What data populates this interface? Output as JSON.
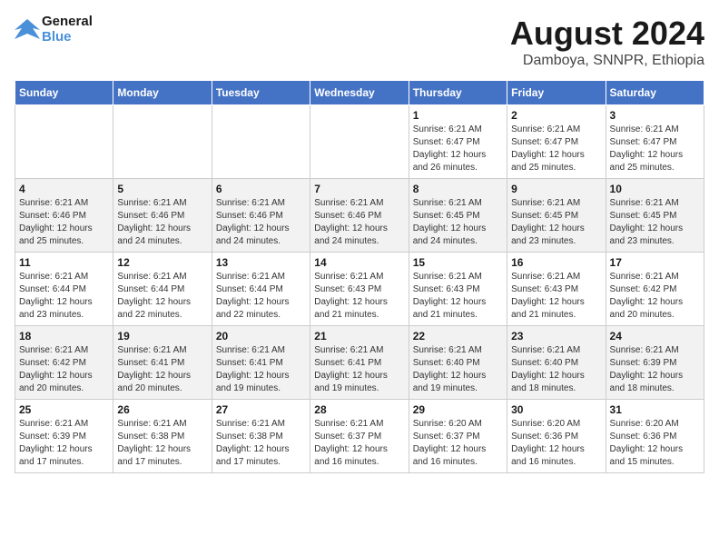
{
  "header": {
    "logo_line1": "General",
    "logo_line2": "Blue",
    "month_year": "August 2024",
    "location": "Damboya, SNNPR, Ethiopia"
  },
  "weekdays": [
    "Sunday",
    "Monday",
    "Tuesday",
    "Wednesday",
    "Thursday",
    "Friday",
    "Saturday"
  ],
  "weeks": [
    [
      {
        "day": "",
        "info": ""
      },
      {
        "day": "",
        "info": ""
      },
      {
        "day": "",
        "info": ""
      },
      {
        "day": "",
        "info": ""
      },
      {
        "day": "1",
        "info": "Sunrise: 6:21 AM\nSunset: 6:47 PM\nDaylight: 12 hours\nand 26 minutes."
      },
      {
        "day": "2",
        "info": "Sunrise: 6:21 AM\nSunset: 6:47 PM\nDaylight: 12 hours\nand 25 minutes."
      },
      {
        "day": "3",
        "info": "Sunrise: 6:21 AM\nSunset: 6:47 PM\nDaylight: 12 hours\nand 25 minutes."
      }
    ],
    [
      {
        "day": "4",
        "info": "Sunrise: 6:21 AM\nSunset: 6:46 PM\nDaylight: 12 hours\nand 25 minutes."
      },
      {
        "day": "5",
        "info": "Sunrise: 6:21 AM\nSunset: 6:46 PM\nDaylight: 12 hours\nand 24 minutes."
      },
      {
        "day": "6",
        "info": "Sunrise: 6:21 AM\nSunset: 6:46 PM\nDaylight: 12 hours\nand 24 minutes."
      },
      {
        "day": "7",
        "info": "Sunrise: 6:21 AM\nSunset: 6:46 PM\nDaylight: 12 hours\nand 24 minutes."
      },
      {
        "day": "8",
        "info": "Sunrise: 6:21 AM\nSunset: 6:45 PM\nDaylight: 12 hours\nand 24 minutes."
      },
      {
        "day": "9",
        "info": "Sunrise: 6:21 AM\nSunset: 6:45 PM\nDaylight: 12 hours\nand 23 minutes."
      },
      {
        "day": "10",
        "info": "Sunrise: 6:21 AM\nSunset: 6:45 PM\nDaylight: 12 hours\nand 23 minutes."
      }
    ],
    [
      {
        "day": "11",
        "info": "Sunrise: 6:21 AM\nSunset: 6:44 PM\nDaylight: 12 hours\nand 23 minutes."
      },
      {
        "day": "12",
        "info": "Sunrise: 6:21 AM\nSunset: 6:44 PM\nDaylight: 12 hours\nand 22 minutes."
      },
      {
        "day": "13",
        "info": "Sunrise: 6:21 AM\nSunset: 6:44 PM\nDaylight: 12 hours\nand 22 minutes."
      },
      {
        "day": "14",
        "info": "Sunrise: 6:21 AM\nSunset: 6:43 PM\nDaylight: 12 hours\nand 21 minutes."
      },
      {
        "day": "15",
        "info": "Sunrise: 6:21 AM\nSunset: 6:43 PM\nDaylight: 12 hours\nand 21 minutes."
      },
      {
        "day": "16",
        "info": "Sunrise: 6:21 AM\nSunset: 6:43 PM\nDaylight: 12 hours\nand 21 minutes."
      },
      {
        "day": "17",
        "info": "Sunrise: 6:21 AM\nSunset: 6:42 PM\nDaylight: 12 hours\nand 20 minutes."
      }
    ],
    [
      {
        "day": "18",
        "info": "Sunrise: 6:21 AM\nSunset: 6:42 PM\nDaylight: 12 hours\nand 20 minutes."
      },
      {
        "day": "19",
        "info": "Sunrise: 6:21 AM\nSunset: 6:41 PM\nDaylight: 12 hours\nand 20 minutes."
      },
      {
        "day": "20",
        "info": "Sunrise: 6:21 AM\nSunset: 6:41 PM\nDaylight: 12 hours\nand 19 minutes."
      },
      {
        "day": "21",
        "info": "Sunrise: 6:21 AM\nSunset: 6:41 PM\nDaylight: 12 hours\nand 19 minutes."
      },
      {
        "day": "22",
        "info": "Sunrise: 6:21 AM\nSunset: 6:40 PM\nDaylight: 12 hours\nand 19 minutes."
      },
      {
        "day": "23",
        "info": "Sunrise: 6:21 AM\nSunset: 6:40 PM\nDaylight: 12 hours\nand 18 minutes."
      },
      {
        "day": "24",
        "info": "Sunrise: 6:21 AM\nSunset: 6:39 PM\nDaylight: 12 hours\nand 18 minutes."
      }
    ],
    [
      {
        "day": "25",
        "info": "Sunrise: 6:21 AM\nSunset: 6:39 PM\nDaylight: 12 hours\nand 17 minutes."
      },
      {
        "day": "26",
        "info": "Sunrise: 6:21 AM\nSunset: 6:38 PM\nDaylight: 12 hours\nand 17 minutes."
      },
      {
        "day": "27",
        "info": "Sunrise: 6:21 AM\nSunset: 6:38 PM\nDaylight: 12 hours\nand 17 minutes."
      },
      {
        "day": "28",
        "info": "Sunrise: 6:21 AM\nSunset: 6:37 PM\nDaylight: 12 hours\nand 16 minutes."
      },
      {
        "day": "29",
        "info": "Sunrise: 6:20 AM\nSunset: 6:37 PM\nDaylight: 12 hours\nand 16 minutes."
      },
      {
        "day": "30",
        "info": "Sunrise: 6:20 AM\nSunset: 6:36 PM\nDaylight: 12 hours\nand 16 minutes."
      },
      {
        "day": "31",
        "info": "Sunrise: 6:20 AM\nSunset: 6:36 PM\nDaylight: 12 hours\nand 15 minutes."
      }
    ]
  ]
}
